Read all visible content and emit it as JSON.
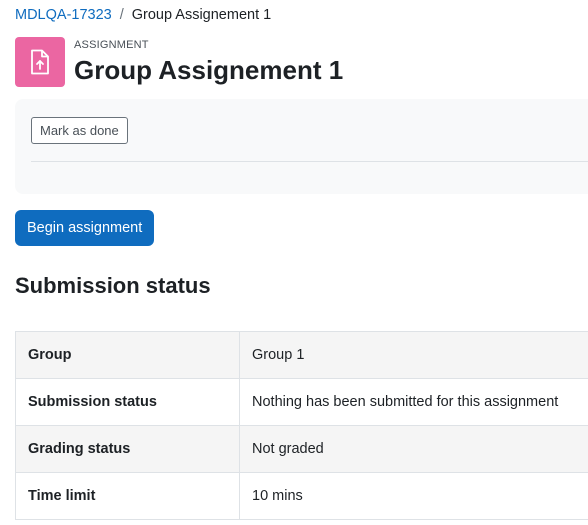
{
  "breadcrumb": {
    "course": "MDLQA-17323",
    "separator": "/",
    "current": "Group Assignement 1"
  },
  "activity": {
    "icon": "assignment-icon",
    "icon_color": "#eb66a2",
    "type_label": "ASSIGNMENT",
    "title": "Group Assignement 1"
  },
  "completion": {
    "mark_done_label": "Mark as done"
  },
  "actions": {
    "begin_label": "Begin assignment",
    "begin_color": "#0f6cbf"
  },
  "submission": {
    "heading": "Submission status",
    "rows": [
      {
        "label": "Group",
        "value": "Group 1"
      },
      {
        "label": "Submission status",
        "value": "Nothing has been submitted for this assignment"
      },
      {
        "label": "Grading status",
        "value": "Not graded"
      },
      {
        "label": "Time limit",
        "value": "10 mins"
      }
    ]
  }
}
